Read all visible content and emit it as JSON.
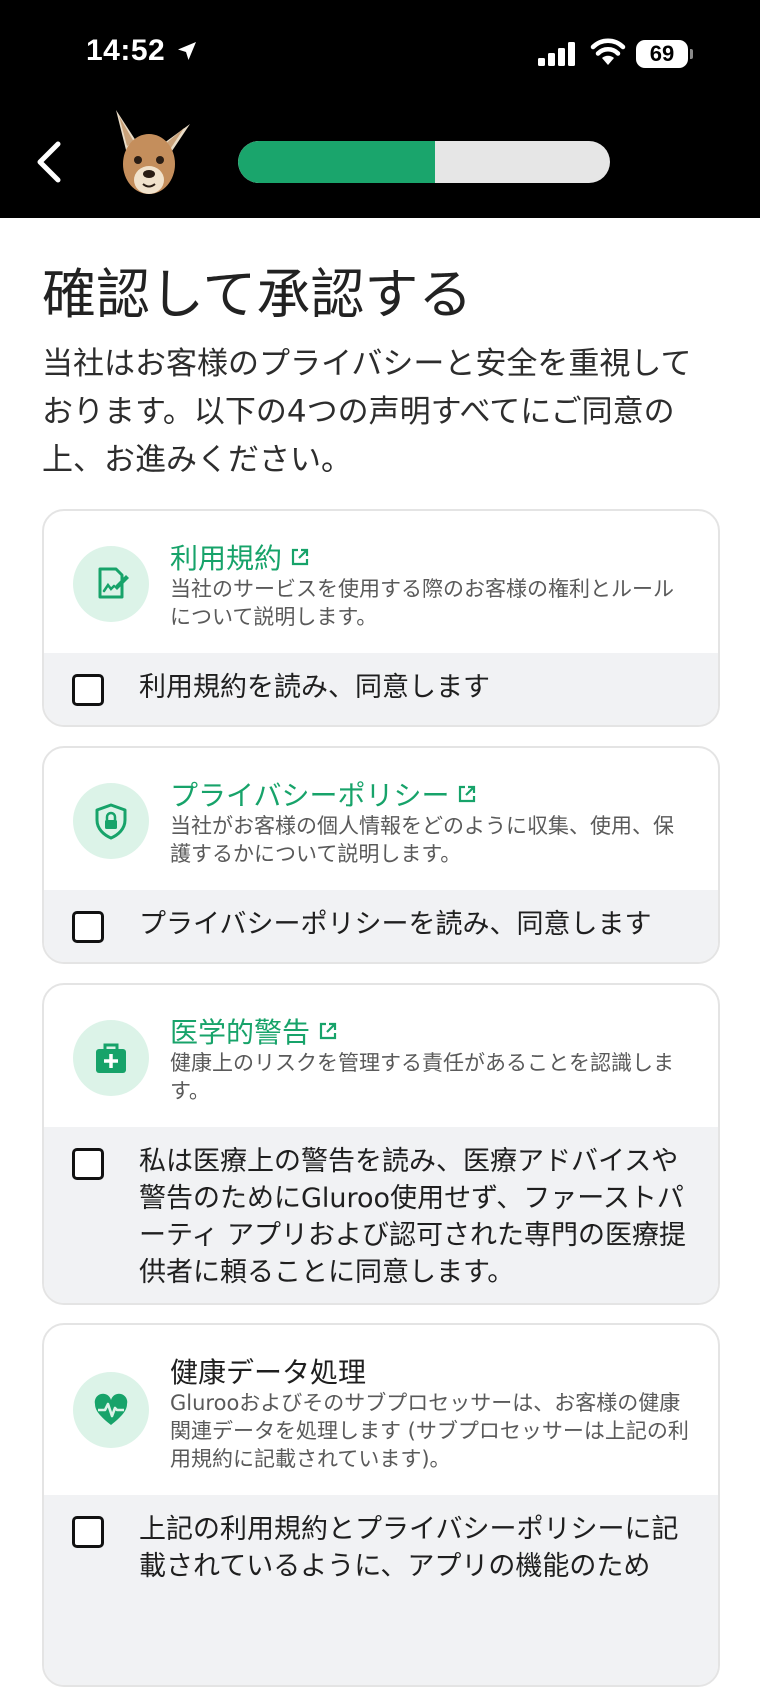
{
  "status_bar": {
    "time": "14:52",
    "battery": "69"
  },
  "progress": {
    "fraction": 0.53
  },
  "colors": {
    "accent": "#1aa56c",
    "icon_bg": "#dcf3e8"
  },
  "page": {
    "title": "確認して承認する",
    "intro": "当社はお客様のプライバシーと安全を重視しております。以下の4つの声明すべてにご同意の上、お進みください。"
  },
  "cards": [
    {
      "icon": "document-sign-icon",
      "title": "利用規約",
      "has_link": true,
      "description": "当社のサービスを使用する際のお客様の権利とルールについて説明します。",
      "agree_label": "利用規約を読み、同意します"
    },
    {
      "icon": "shield-lock-icon",
      "title": "プライバシーポリシー",
      "has_link": true,
      "description": "当社がお客様の個人情報をどのように収集、使用、保護するかについて説明します。",
      "agree_label": "プライバシーポリシーを読み、同意します"
    },
    {
      "icon": "medical-bag-icon",
      "title": "医学的警告",
      "has_link": true,
      "description": "健康上のリスクを管理する責任があることを認識します。",
      "agree_label": "私は医療上の警告を読み、医療アドバイスや警告のためにGluroo使用せず、ファーストパーティ アプリおよび認可された専門の医療提供者に頼ることに同意します。"
    },
    {
      "icon": "heart-pulse-icon",
      "title": "健康データ処理",
      "has_link": false,
      "description": "Glurooおよびそのサブプロセッサーは、お客様の健康関連データを処理します (サブプロセッサーは上記の利用規約に記載されています)。",
      "agree_label": "上記の利用規約とプライバシーポリシーに記載されているように、アプリの機能のため"
    }
  ]
}
